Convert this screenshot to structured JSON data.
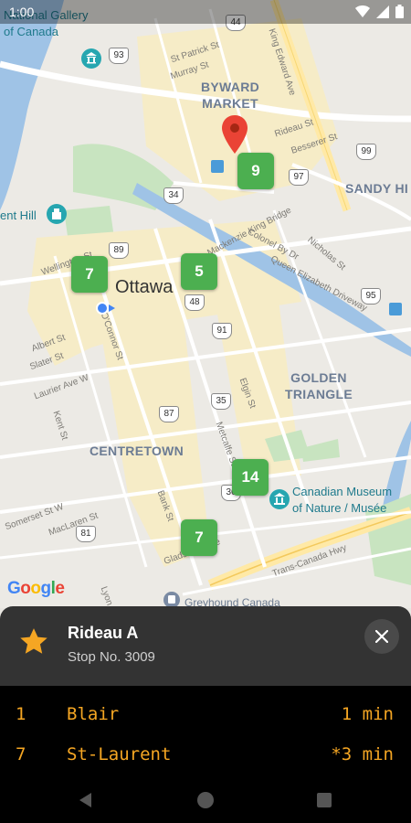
{
  "status_bar": {
    "time": "1:00"
  },
  "map": {
    "districts": {
      "byward": "BYWARD\nMARKET",
      "sandy_hill": "SANDY HI",
      "golden_triangle": "GOLDEN\nTRIANGLE",
      "centretown": "CENTRETOWN"
    },
    "city": "Ottawa",
    "pois": {
      "national_gallery": "National Gallery\nof Canada",
      "parliament": "ent Hill",
      "museum": "Canadian Museum\nof Nature / Musée",
      "greyhound": "Greyhound Canada"
    },
    "streets": {
      "st_patrick": "St Patrick St",
      "murray": "Murray St",
      "king_edward": "King Edward Ave",
      "rideau": "Rideau St",
      "besserer": "Besserer St",
      "mackenzie_king": "Mackenzie King Bridge",
      "colonel_by": "Colonel By Dr",
      "queen_elizabeth": "Queen Elizabeth Driveway",
      "nicholas": "Nicholas St",
      "wellington": "Wellington St",
      "oconnor": "O'Connor St",
      "albert": "Albert St",
      "slater": "Slater St",
      "laurier": "Laurier Ave W",
      "kent": "Kent St",
      "elgin": "Elgin St",
      "metcalfe": "Metcalfe St",
      "bank": "Bank St",
      "somerset": "Somerset St W",
      "maclaren": "MacLaren St",
      "gladstone": "Gladstone Ave",
      "lyon": "Lyon St",
      "trans_canada": "Trans-Canada Hwy"
    },
    "shields": [
      "44",
      "93",
      "99",
      "97",
      "34",
      "89",
      "48",
      "91",
      "95",
      "35",
      "87",
      "36",
      "81"
    ],
    "clusters": [
      "9",
      "5",
      "7",
      "14",
      "7"
    ],
    "attribution": "Google"
  },
  "stop": {
    "name": "Rideau A",
    "number": "Stop No. 3009"
  },
  "departures": [
    {
      "route": "1",
      "destination": "Blair",
      "time": "1 min"
    },
    {
      "route": "7",
      "destination": "St-Laurent",
      "time": "*3 min"
    }
  ],
  "colors": {
    "accent": "#f5a623",
    "cluster": "#4caf50",
    "sheet": "#333333"
  },
  "icons": {
    "favorite": "star-icon",
    "close": "close-icon",
    "location": "red-pin-icon"
  }
}
